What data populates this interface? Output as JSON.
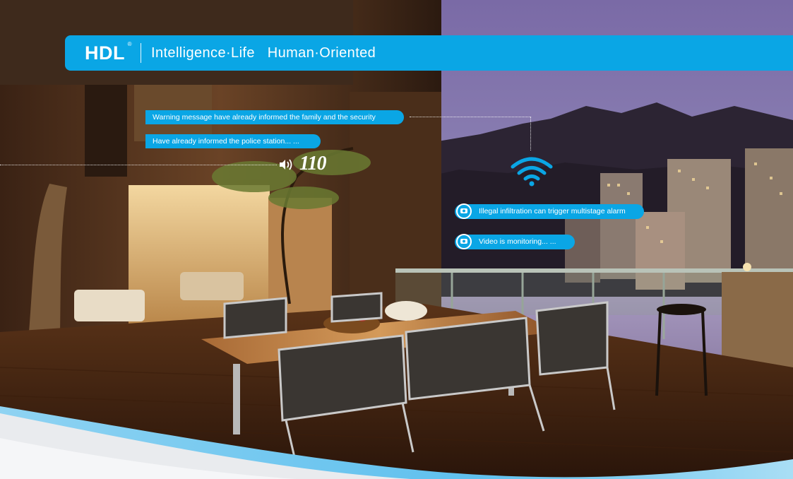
{
  "banner": {
    "logo": "HDL",
    "registered_mark": "®",
    "tagline": "Intelligence·Life   Human·Oriented"
  },
  "alerts_left": [
    {
      "text": "Warning message have already informed the family and the security"
    },
    {
      "text": "Have already informed the police station... ..."
    }
  ],
  "emergency_number": "110",
  "alerts_right": [
    {
      "text": "Illegal infiltration can trigger multistage alarm"
    },
    {
      "text": "Video is monitoring... ..."
    }
  ],
  "icons": [
    "speaker-icon",
    "wifi-icon",
    "camera-icon"
  ],
  "colors": {
    "accent": "#0aa6e5",
    "text": "#ffffff"
  }
}
